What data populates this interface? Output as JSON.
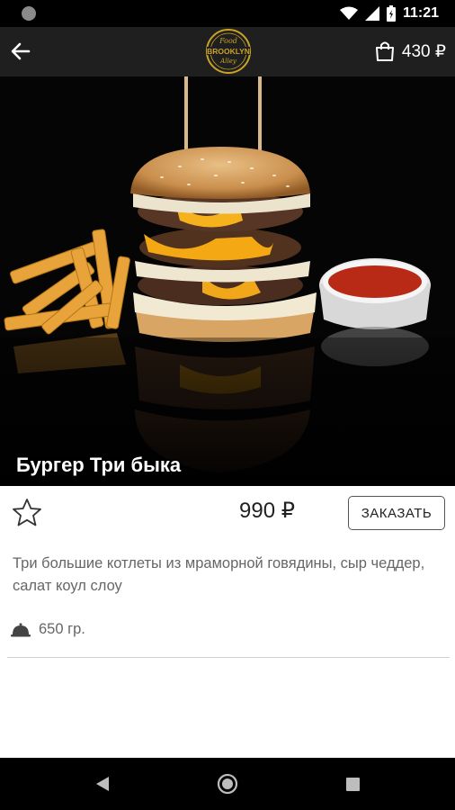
{
  "status_bar": {
    "time": "11:21"
  },
  "app_bar": {
    "logo_text": [
      "Food",
      "BROOKLYN",
      "Alley"
    ],
    "cart_total": "430 ₽"
  },
  "product": {
    "title": "Бургер Три быка",
    "price": "990 ₽",
    "order_label": "ЗАКАЗАТЬ",
    "description": "Три большие котлеты из мраморной говядины, сыр чеддер, салат коул слоу",
    "weight": "650 гр."
  },
  "colors": {
    "app_bar": "#1f1f1f",
    "status_bar": "#000000",
    "hero_background": "#050505",
    "text_secondary": "#666666",
    "logo_gold": "#c9a227"
  },
  "icons": {
    "back": "arrow-left-icon",
    "cart": "shopping-bag-icon",
    "favorite": "star-outline-icon",
    "weight": "cloche-icon"
  }
}
